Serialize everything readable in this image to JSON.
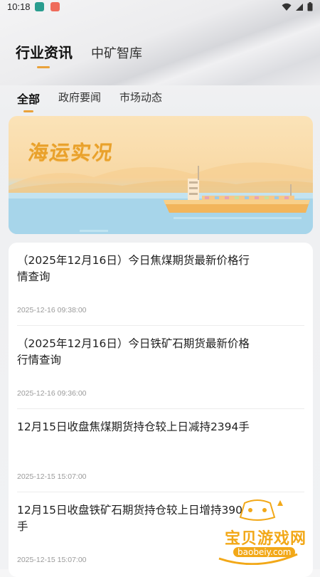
{
  "status_bar": {
    "time": "10:18"
  },
  "top_tabs": [
    {
      "label": "行业资讯",
      "active": true
    },
    {
      "label": "中矿智库",
      "active": false
    }
  ],
  "sub_tabs": [
    {
      "label": "全部",
      "active": true
    },
    {
      "label": "政府要闻",
      "active": false
    },
    {
      "label": "市场动态",
      "active": false
    }
  ],
  "banner": {
    "title": "海运实况"
  },
  "news": [
    {
      "title": "（2025年12月16日）今日焦煤期货最新价格行情查询",
      "date": "2025-12-16 09:38:00"
    },
    {
      "title": "（2025年12月16日）今日铁矿石期货最新价格行情查询",
      "date": "2025-12-16 09:36:00"
    },
    {
      "title": "12月15日收盘焦煤期货持仓较上日减持2394手",
      "date": "2025-12-15 15:07:00"
    },
    {
      "title": "12月15日收盘铁矿石期货持仓较上日增持3908手",
      "date": "2025-12-15 15:07:00"
    }
  ],
  "watermark": {
    "text": "宝贝游戏网",
    "url": "baobeiy.com"
  },
  "colors": {
    "accent": "#e9a23b",
    "banner_title": "#e9a12b"
  }
}
